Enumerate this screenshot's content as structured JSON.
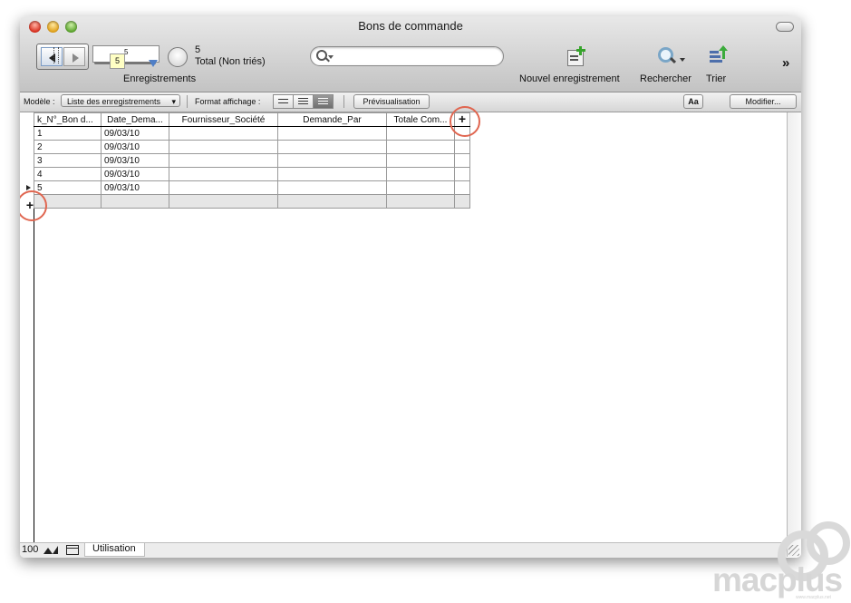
{
  "window": {
    "title": "Bons de commande"
  },
  "toolbar": {
    "record_field": "5",
    "slider_tip": "5",
    "record_count": "5",
    "total_label": "Total (Non triés)",
    "records_label": "Enregistrements",
    "search_placeholder": "",
    "new_record_label": "Nouvel enregistrement",
    "find_label": "Rechercher",
    "sort_label": "Trier",
    "more": "»"
  },
  "layout_bar": {
    "model_label": "Modèle :",
    "model_value": "Liste des enregistrements",
    "display_label": "Format affichage :",
    "preview_button": "Prévisualisation",
    "aa_button": "Aa",
    "modify_button": "Modifier..."
  },
  "table": {
    "columns": [
      "k_N°_Bon d...",
      "Date_Dema...",
      "Fournisseur_Société",
      "Demande_Par",
      "Totale Com..."
    ],
    "rows": [
      [
        "1",
        "09/03/10",
        "",
        "",
        ""
      ],
      [
        "2",
        "09/03/10",
        "",
        "",
        ""
      ],
      [
        "3",
        "09/03/10",
        "",
        "",
        ""
      ],
      [
        "4",
        "09/03/10",
        "",
        "",
        ""
      ],
      [
        "5",
        "09/03/10",
        "",
        "",
        ""
      ]
    ],
    "add_column": "+",
    "add_row": "+"
  },
  "status_bar": {
    "zoom": "100",
    "mode": "Utilisation"
  },
  "watermark": {
    "brand": "macplus",
    "url": "www.macplus.net"
  }
}
